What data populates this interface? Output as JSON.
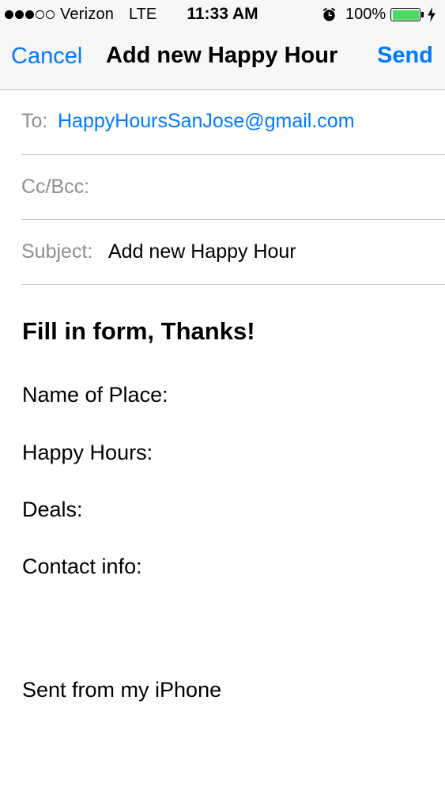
{
  "status_bar": {
    "signal_bars_filled": 3,
    "signal_bars_total": 5,
    "carrier": "Verizon",
    "network": "LTE",
    "time": "11:33 AM",
    "alarm_icon": "alarm-clock-icon",
    "battery_percent": "100%",
    "battery_level": 1.0,
    "battery_color": "#4cd964",
    "charging_icon": "lightning-bolt-icon"
  },
  "nav": {
    "cancel_label": "Cancel",
    "title": "Add new Happy Hour",
    "send_label": "Send",
    "accent_color": "#007aff"
  },
  "fields": {
    "to_label": "To:",
    "to_value": "HappyHoursSanJose@gmail.com",
    "cc_label": "Cc/Bcc:",
    "subject_label": "Subject:",
    "subject_value": "Add new Happy Hour"
  },
  "body": {
    "heading": "Fill in form, Thanks!",
    "lines": [
      "Name of Place:",
      "Happy Hours:",
      "Deals:",
      "Contact info:"
    ],
    "signature": "Sent from my iPhone"
  }
}
